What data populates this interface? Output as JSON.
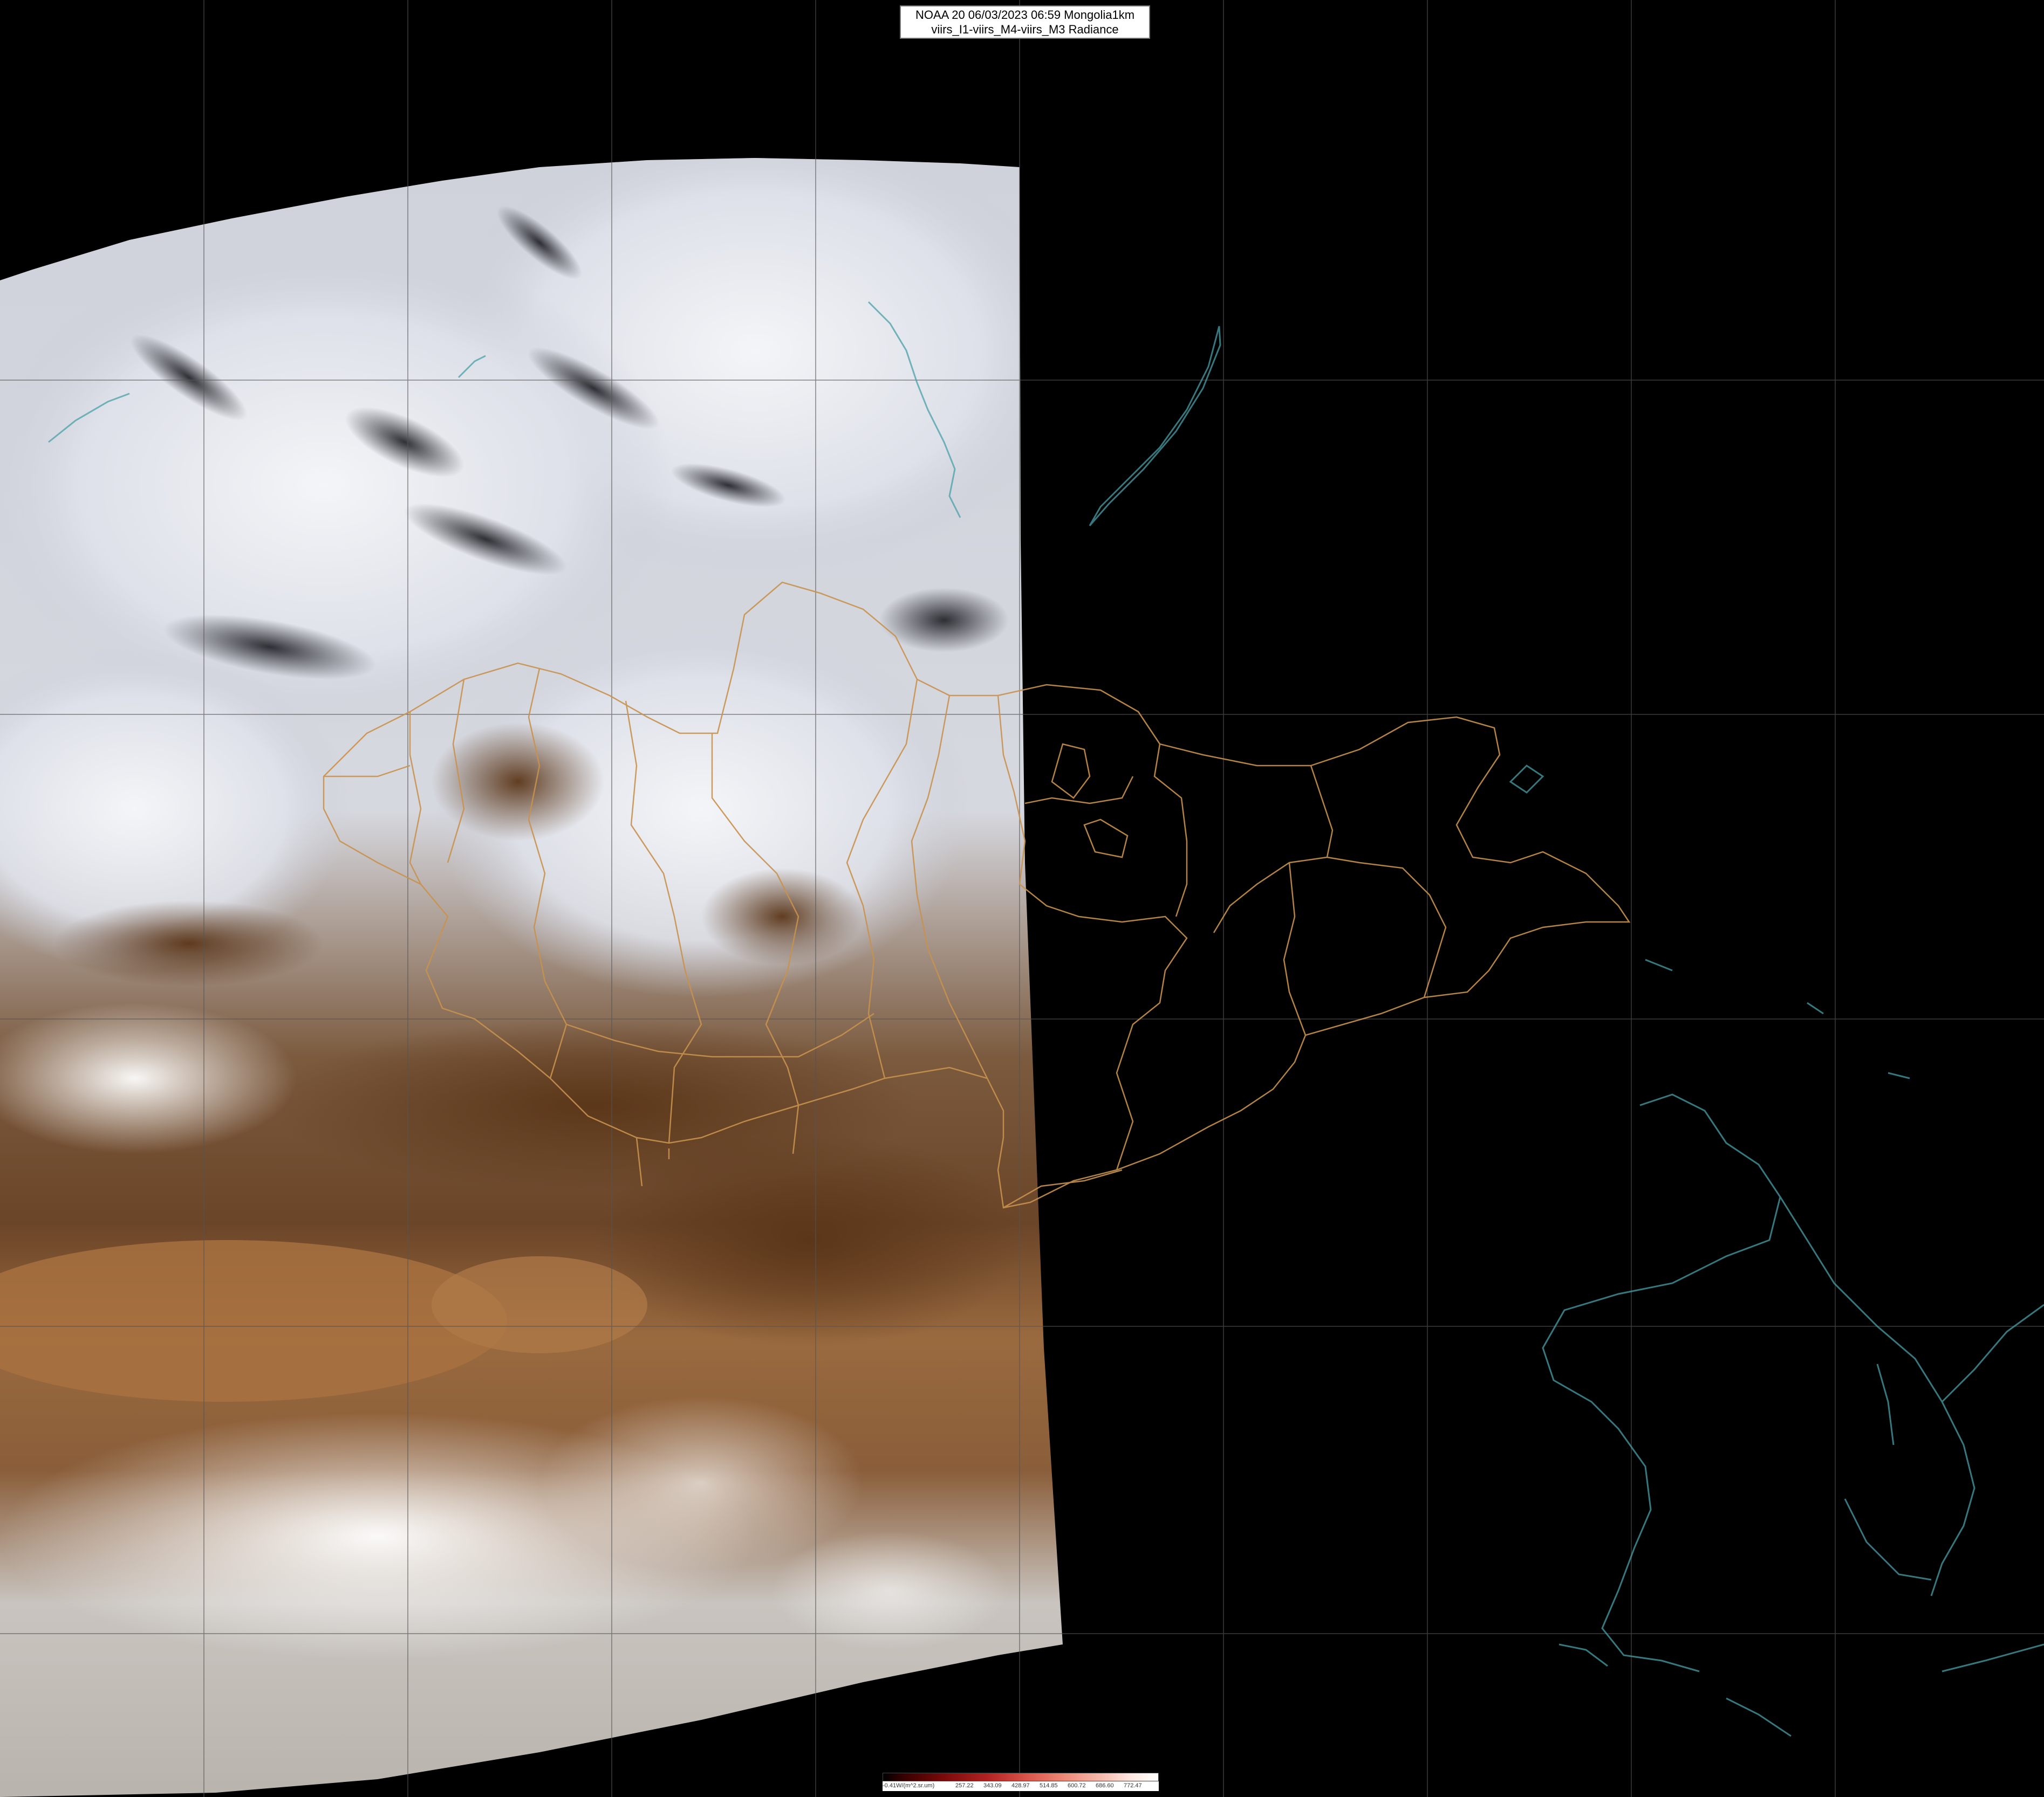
{
  "title": {
    "line1": "NOAA 20 06/03/2023 06:59 Mongolia1km",
    "line2": "viirs_I1-viirs_M4-viirs_M3 Radiance"
  },
  "legend": {
    "labels": [
      "-0.41W/(m^2.sr.um)",
      "257.22",
      "343.09",
      "428.97",
      "514.85",
      "600.72",
      "686.60",
      "772.47"
    ]
  },
  "colors": {
    "background": "#000000",
    "grid": "#555555",
    "border_lines": "#c8924e",
    "coast_lines": "#4aa0a8",
    "cloud": "#e6e8ee",
    "desert": "#8a5a33"
  }
}
